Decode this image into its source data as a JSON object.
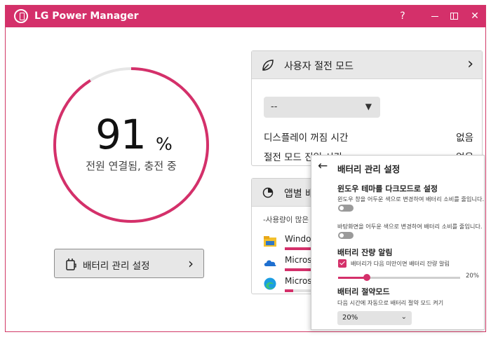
{
  "app": {
    "title": "LG Power Manager",
    "help_label": "?",
    "close_label": "✕"
  },
  "colors": {
    "accent": "#d4306a",
    "ring_track": "#e6e6e6"
  },
  "battery": {
    "percent_text": "91",
    "percent_sign": "%",
    "level": 0.91,
    "status": "전원 연결됨, 충전 중",
    "settings_button_label": "배터리 관리 설정"
  },
  "power_mode_card": {
    "title": "사용자 절전 모드",
    "mode_value": "--",
    "rows": [
      {
        "label": "디스플레이 꺼짐 시간",
        "value": "없음"
      },
      {
        "label": "절전 모드 진입 시간",
        "value": "없음"
      }
    ]
  },
  "app_usage_card": {
    "title": "앱별 배터",
    "subtitle": "-사용량이 많은 앱",
    "apps": [
      {
        "name": "Windows",
        "icon": "folder-icon",
        "usage": 0.95
      },
      {
        "name": "Microsof",
        "icon": "onedrive-icon",
        "usage": 0.8
      },
      {
        "name": "Microsof",
        "icon": "edge-icon",
        "usage": 0.2
      }
    ]
  },
  "battery_panel": {
    "title": "배터리 관리 설정",
    "dark_mode": {
      "title": "윈도우 테마를 다크모드로 설정",
      "desc": "윈도우 창을 어두운 색으로 변경하여 배터리 소비를 줄입니다.",
      "on": false
    },
    "wallpaper": {
      "desc": "바탕화면을 어두운 색으로 변경하여 배터리 소비를 줄입니다.",
      "on": false
    },
    "low_alert": {
      "title": "배터리 잔량 알림",
      "check_label": "배터리가 다음 미만이면 배터리 잔량 알림",
      "checked": true,
      "level": 0.2,
      "value_text": "20%"
    },
    "saver": {
      "title": "배터리 절약모드",
      "desc": "다음 시간에 자동으로 배터리 절약 모드 켜기",
      "value": "20%"
    }
  }
}
